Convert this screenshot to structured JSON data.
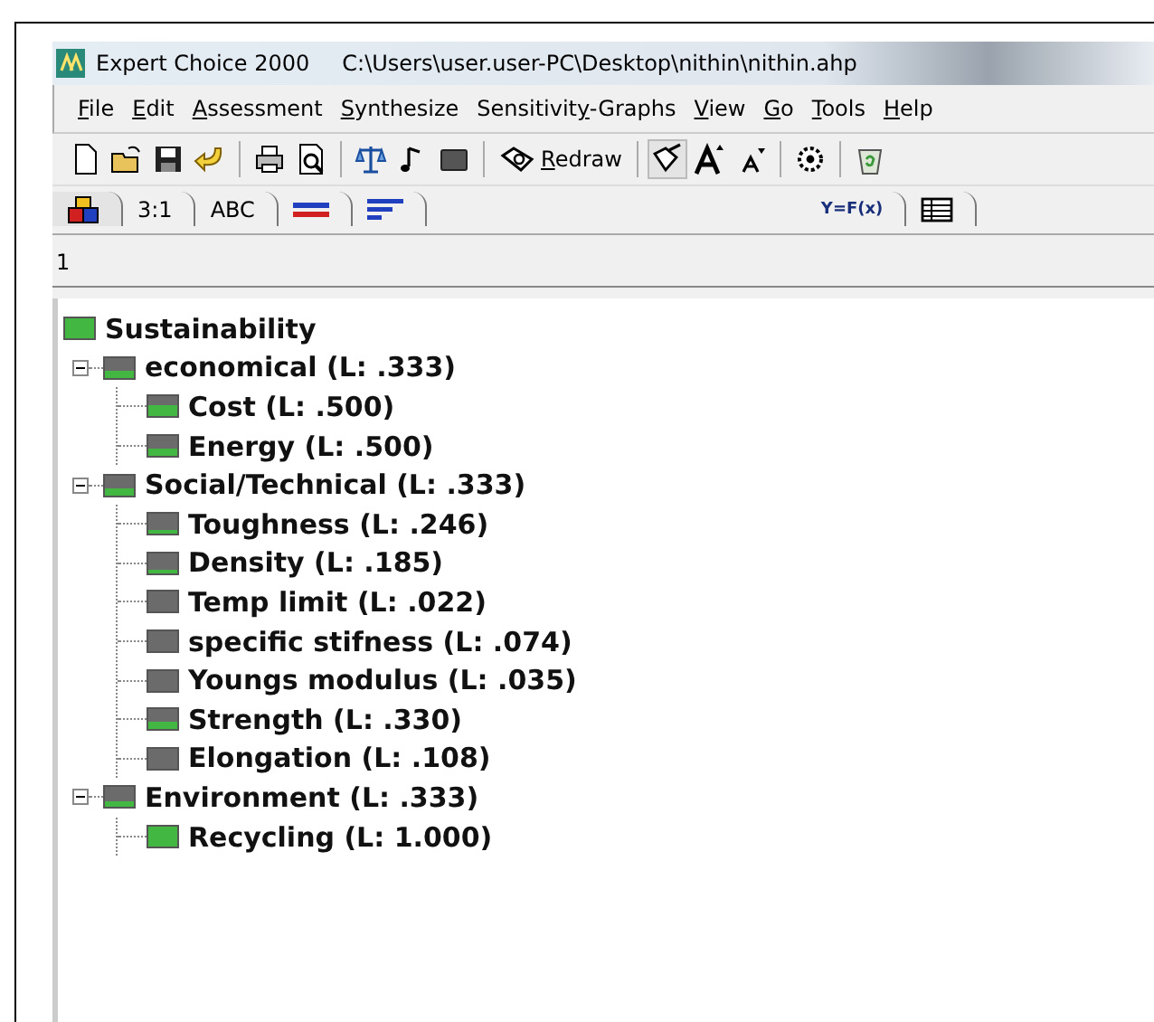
{
  "window": {
    "title": "Expert Choice 2000",
    "path": "C:\\Users\\user.user-PC\\Desktop\\nithin\\nithin.ahp"
  },
  "menu": [
    {
      "key": "F",
      "post": "ile"
    },
    {
      "key": "E",
      "post": "dit"
    },
    {
      "key": "A",
      "post": "ssessment"
    },
    {
      "key": "S",
      "post": "ynthesize"
    },
    {
      "pre": "Sensitivit",
      "key": "y",
      "post": "-Graphs"
    },
    {
      "key": "V",
      "post": "iew"
    },
    {
      "key": "G",
      "post": "o"
    },
    {
      "key": "T",
      "post": "ools"
    },
    {
      "key": "H",
      "post": "elp"
    }
  ],
  "toolbar": [
    {
      "kind": "new"
    },
    {
      "kind": "open"
    },
    {
      "kind": "save"
    },
    {
      "kind": "undo"
    },
    {
      "kind": "sep"
    },
    {
      "kind": "print"
    },
    {
      "kind": "preview"
    },
    {
      "kind": "sep"
    },
    {
      "kind": "balance"
    },
    {
      "kind": "note"
    },
    {
      "kind": "box"
    },
    {
      "kind": "sep"
    },
    {
      "kind": "redraw",
      "key": "R",
      "post": "edraw"
    },
    {
      "kind": "sep"
    },
    {
      "kind": "pen"
    },
    {
      "kind": "bigger"
    },
    {
      "kind": "smaller"
    },
    {
      "kind": "sep"
    },
    {
      "kind": "gear"
    },
    {
      "kind": "sep"
    },
    {
      "kind": "bin"
    }
  ],
  "tabs": [
    {
      "kind": "cubes",
      "selected": true
    },
    {
      "kind": "text",
      "label": "3:1",
      "selected": false
    },
    {
      "kind": "text",
      "label": "ABC",
      "selected": false
    },
    {
      "kind": "flag",
      "selected": false
    },
    {
      "kind": "bars",
      "selected": false
    },
    {
      "kind": "formula",
      "label": "Y=F(x)",
      "selected": false
    },
    {
      "kind": "grid",
      "selected": false
    }
  ],
  "node_field": {
    "value": "1"
  },
  "tree": {
    "label": "Sustainability",
    "kind": "full",
    "children": [
      {
        "label": "economical (L: .333)",
        "kind": "half",
        "expanded": true,
        "children": [
          {
            "label": "Cost (L: .500)",
            "kind": "most"
          },
          {
            "label": "Energy (L: .500)",
            "kind": "half"
          }
        ]
      },
      {
        "label": "Social/Technical (L: .333)",
        "kind": "half",
        "expanded": true,
        "children": [
          {
            "label": "Toughness (L: .246)",
            "kind": "low"
          },
          {
            "label": "Density (L: .185)",
            "kind": "low"
          },
          {
            "label": "Temp limit (L: .022)",
            "kind": "empty"
          },
          {
            "label": "specific stifness (L: .074)",
            "kind": "empty"
          },
          {
            "label": "Youngs modulus (L: .035)",
            "kind": "empty"
          },
          {
            "label": "Strength (L: .330)",
            "kind": "half"
          },
          {
            "label": "Elongation (L: .108)",
            "kind": "empty"
          }
        ]
      },
      {
        "label": "Environment (L: .333)",
        "kind": "half",
        "expanded": true,
        "children": [
          {
            "label": "Recycling (L: 1.000)",
            "kind": "full"
          }
        ]
      }
    ]
  }
}
